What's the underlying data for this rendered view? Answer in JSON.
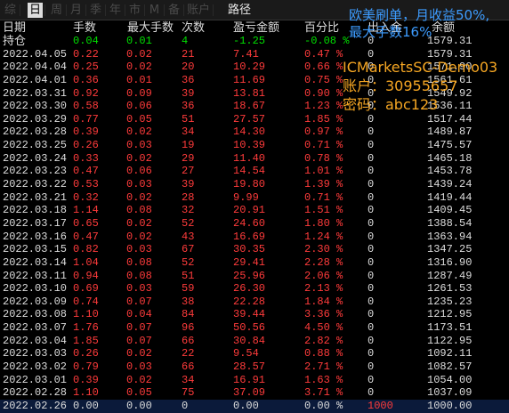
{
  "tabs": [
    "综",
    "日",
    "周",
    "月",
    "季",
    "年",
    "市",
    "M",
    "备",
    "账户",
    "路径"
  ],
  "active_tab": 1,
  "headers": [
    "日期",
    "手数",
    "最大手数",
    "次数",
    "盈亏金额",
    "百分比",
    "出入金",
    "余额"
  ],
  "holding": {
    "label": "持仓",
    "lots": "0.04",
    "max_lots": "0.01",
    "count": "4",
    "pnl": "-1.25",
    "pct": "-0.08 %",
    "deposit": "0",
    "balance": "1579.31"
  },
  "rows": [
    {
      "date": "2022.04.05",
      "lots": "0.22",
      "max_lots": "0.02",
      "count": "21",
      "pnl": "7.41",
      "pct": "0.47 %",
      "deposit": "0",
      "balance": "1579.31"
    },
    {
      "date": "2022.04.04",
      "lots": "0.25",
      "max_lots": "0.02",
      "count": "20",
      "pnl": "10.29",
      "pct": "0.66 %",
      "deposit": "0",
      "balance": "1571.90"
    },
    {
      "date": "2022.04.01",
      "lots": "0.36",
      "max_lots": "0.01",
      "count": "36",
      "pnl": "11.69",
      "pct": "0.75 %",
      "deposit": "0",
      "balance": "1561.61"
    },
    {
      "date": "2022.03.31",
      "lots": "0.92",
      "max_lots": "0.09",
      "count": "39",
      "pnl": "13.81",
      "pct": "0.90 %",
      "deposit": "0",
      "balance": "1549.92"
    },
    {
      "date": "2022.03.30",
      "lots": "0.58",
      "max_lots": "0.06",
      "count": "36",
      "pnl": "18.67",
      "pct": "1.23 %",
      "deposit": "0",
      "balance": "1536.11"
    },
    {
      "date": "2022.03.29",
      "lots": "0.77",
      "max_lots": "0.05",
      "count": "51",
      "pnl": "27.57",
      "pct": "1.85 %",
      "deposit": "0",
      "balance": "1517.44"
    },
    {
      "date": "2022.03.28",
      "lots": "0.39",
      "max_lots": "0.02",
      "count": "34",
      "pnl": "14.30",
      "pct": "0.97 %",
      "deposit": "0",
      "balance": "1489.87"
    },
    {
      "date": "2022.03.25",
      "lots": "0.26",
      "max_lots": "0.03",
      "count": "19",
      "pnl": "10.39",
      "pct": "0.71 %",
      "deposit": "0",
      "balance": "1475.57"
    },
    {
      "date": "2022.03.24",
      "lots": "0.33",
      "max_lots": "0.02",
      "count": "29",
      "pnl": "11.40",
      "pct": "0.78 %",
      "deposit": "0",
      "balance": "1465.18"
    },
    {
      "date": "2022.03.23",
      "lots": "0.47",
      "max_lots": "0.06",
      "count": "27",
      "pnl": "14.54",
      "pct": "1.01 %",
      "deposit": "0",
      "balance": "1453.78"
    },
    {
      "date": "2022.03.22",
      "lots": "0.53",
      "max_lots": "0.03",
      "count": "39",
      "pnl": "19.80",
      "pct": "1.39 %",
      "deposit": "0",
      "balance": "1439.24"
    },
    {
      "date": "2022.03.21",
      "lots": "0.32",
      "max_lots": "0.02",
      "count": "28",
      "pnl": "9.99",
      "pct": "0.71 %",
      "deposit": "0",
      "balance": "1419.44"
    },
    {
      "date": "2022.03.18",
      "lots": "1.14",
      "max_lots": "0.08",
      "count": "32",
      "pnl": "20.91",
      "pct": "1.51 %",
      "deposit": "0",
      "balance": "1409.45"
    },
    {
      "date": "2022.03.17",
      "lots": "0.65",
      "max_lots": "0.02",
      "count": "52",
      "pnl": "24.60",
      "pct": "1.80 %",
      "deposit": "0",
      "balance": "1388.54"
    },
    {
      "date": "2022.03.16",
      "lots": "0.47",
      "max_lots": "0.02",
      "count": "43",
      "pnl": "16.69",
      "pct": "1.24 %",
      "deposit": "0",
      "balance": "1363.94"
    },
    {
      "date": "2022.03.15",
      "lots": "0.82",
      "max_lots": "0.03",
      "count": "67",
      "pnl": "30.35",
      "pct": "2.30 %",
      "deposit": "0",
      "balance": "1347.25"
    },
    {
      "date": "2022.03.14",
      "lots": "1.04",
      "max_lots": "0.08",
      "count": "52",
      "pnl": "29.41",
      "pct": "2.28 %",
      "deposit": "0",
      "balance": "1316.90"
    },
    {
      "date": "2022.03.11",
      "lots": "0.94",
      "max_lots": "0.08",
      "count": "51",
      "pnl": "25.96",
      "pct": "2.06 %",
      "deposit": "0",
      "balance": "1287.49"
    },
    {
      "date": "2022.03.10",
      "lots": "0.69",
      "max_lots": "0.03",
      "count": "59",
      "pnl": "26.30",
      "pct": "2.13 %",
      "deposit": "0",
      "balance": "1261.53"
    },
    {
      "date": "2022.03.09",
      "lots": "0.74",
      "max_lots": "0.07",
      "count": "38",
      "pnl": "22.28",
      "pct": "1.84 %",
      "deposit": "0",
      "balance": "1235.23"
    },
    {
      "date": "2022.03.08",
      "lots": "1.10",
      "max_lots": "0.04",
      "count": "84",
      "pnl": "39.44",
      "pct": "3.36 %",
      "deposit": "0",
      "balance": "1212.95"
    },
    {
      "date": "2022.03.07",
      "lots": "1.76",
      "max_lots": "0.07",
      "count": "96",
      "pnl": "50.56",
      "pct": "4.50 %",
      "deposit": "0",
      "balance": "1173.51"
    },
    {
      "date": "2022.03.04",
      "lots": "1.85",
      "max_lots": "0.07",
      "count": "66",
      "pnl": "30.84",
      "pct": "2.82 %",
      "deposit": "0",
      "balance": "1122.95"
    },
    {
      "date": "2022.03.03",
      "lots": "0.26",
      "max_lots": "0.02",
      "count": "22",
      "pnl": "9.54",
      "pct": "0.88 %",
      "deposit": "0",
      "balance": "1092.11"
    },
    {
      "date": "2022.03.02",
      "lots": "0.79",
      "max_lots": "0.03",
      "count": "66",
      "pnl": "28.57",
      "pct": "2.71 %",
      "deposit": "0",
      "balance": "1082.57"
    },
    {
      "date": "2022.03.01",
      "lots": "0.39",
      "max_lots": "0.02",
      "count": "34",
      "pnl": "16.91",
      "pct": "1.63 %",
      "deposit": "0",
      "balance": "1054.00"
    },
    {
      "date": "2022.02.28",
      "lots": "1.10",
      "max_lots": "0.05",
      "count": "75",
      "pnl": "37.09",
      "pct": "3.71 %",
      "deposit": "0",
      "balance": "1037.09"
    },
    {
      "date": "2022.02.26",
      "lots": "0.00",
      "max_lots": "0.00",
      "count": "0",
      "pnl": "0.00",
      "pct": "0.00 %",
      "deposit": "1000",
      "balance": "1000.00"
    }
  ],
  "overlay": {
    "note": "欧美刷单，月收益50%,",
    "note2": "最大手数16%",
    "broker": "ICMarketsSC-Demo03",
    "account": "账户：30955657",
    "password": "密码：abc123"
  },
  "colors": {
    "positive": "#ff3b3b",
    "holding": "#00e000",
    "neutral": "#dddddd",
    "deposit": "#ff3b3b",
    "note": "#3d9cff",
    "overlay": "#f5a623"
  }
}
